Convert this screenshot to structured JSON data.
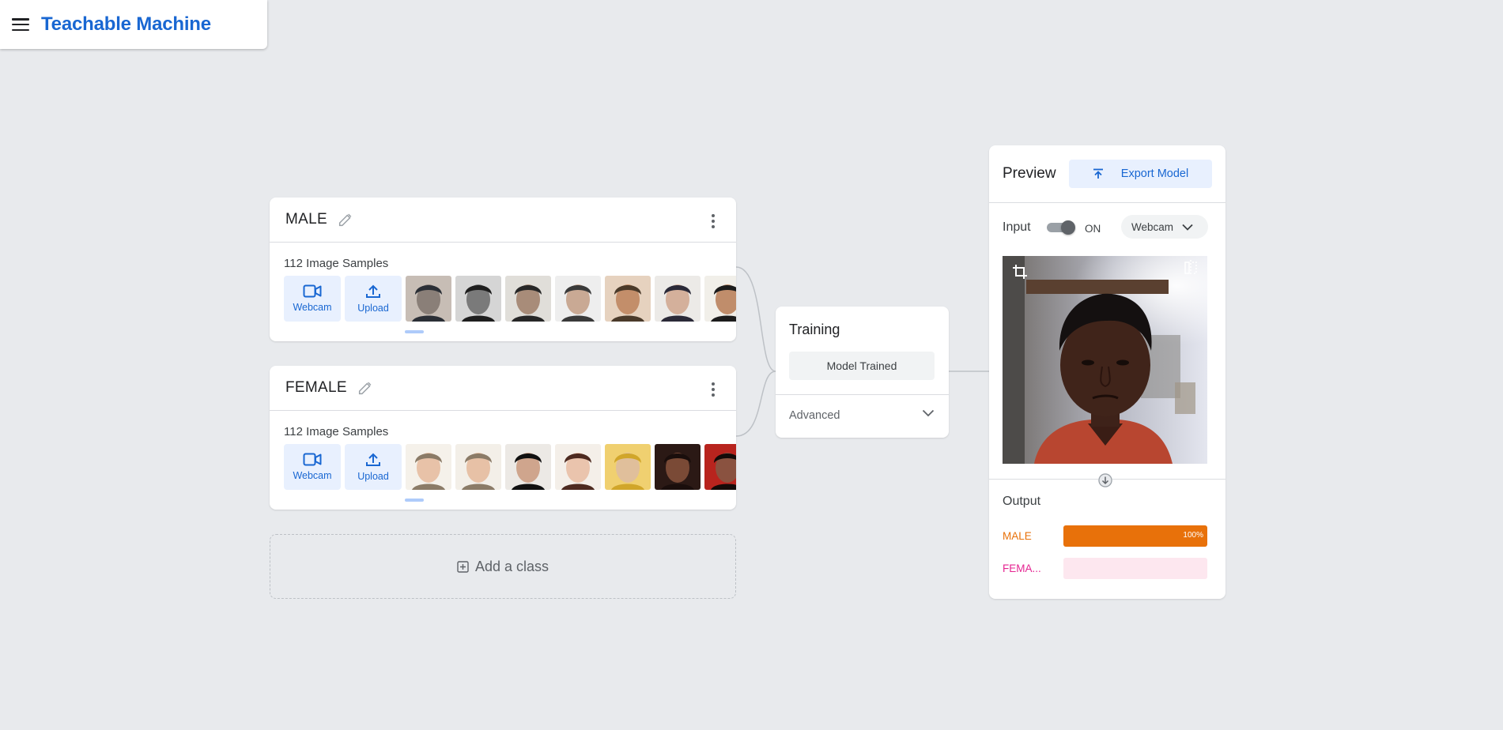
{
  "app": {
    "title": "Teachable Machine"
  },
  "classes": [
    {
      "name": "MALE",
      "sample_count_label": "112 Image Samples",
      "webcam_label": "Webcam",
      "upload_label": "Upload",
      "thumb_colors": [
        [
          "#2b2f36",
          "#8a7f78",
          "#c7bdb5"
        ],
        [
          "#1e1e1e",
          "#7a7a7a",
          "#d5d5d5"
        ],
        [
          "#272727",
          "#a88c79",
          "#e0ded9"
        ],
        [
          "#3a3a3a",
          "#c9a994",
          "#eeeeee"
        ],
        [
          "#4a3a2a",
          "#c38e6a",
          "#e6d2bf"
        ],
        [
          "#2b2a38",
          "#d4b09b",
          "#eceae7"
        ],
        [
          "#1c1c1c",
          "#c08d6b",
          "#f1efe9"
        ]
      ]
    },
    {
      "name": "FEMALE",
      "sample_count_label": "112 Image Samples",
      "webcam_label": "Webcam",
      "upload_label": "Upload",
      "thumb_colors": [
        [
          "#8b7b67",
          "#e8c2a8",
          "#f5f1ea"
        ],
        [
          "#8b7b67",
          "#e7c1a6",
          "#f3efe8"
        ],
        [
          "#111111",
          "#cfa58d",
          "#ece9e5"
        ],
        [
          "#4d2a20",
          "#eac4ad",
          "#f4efe9"
        ],
        [
          "#d1a62a",
          "#e0bf9b",
          "#f0d070"
        ],
        [
          "#1a0e0c",
          "#7a4a36",
          "#2b1915"
        ],
        [
          "#140b09",
          "#8a5240",
          "#b8241e"
        ]
      ]
    }
  ],
  "add_class": {
    "label": "Add a class"
  },
  "training": {
    "title": "Training",
    "status_label": "Model Trained",
    "advanced_label": "Advanced"
  },
  "preview": {
    "title": "Preview",
    "export_label": "Export Model",
    "input_label": "Input",
    "toggle_state_label": "ON",
    "input_source": "Webcam",
    "output_label": "Output",
    "outputs": [
      {
        "name": "MALE",
        "color": "#e8710a",
        "track": "#fce8d3",
        "value": 1.0,
        "pct_label": "100%"
      },
      {
        "name": "FEMA...",
        "color": "#e52592",
        "track": "#fde7ef",
        "value": 0.0,
        "pct_label": ""
      }
    ]
  },
  "icons": {
    "menu": "menu-icon",
    "edit": "pencil-icon",
    "more": "more-vert-icon",
    "webcam": "videocam-icon",
    "upload": "upload-icon",
    "add": "add-box-icon",
    "export": "upload-arrow-icon",
    "crop": "crop-icon",
    "flip": "flip-icon",
    "chevron": "chevron-down-icon",
    "expand": "arrow-down-circle-icon"
  }
}
